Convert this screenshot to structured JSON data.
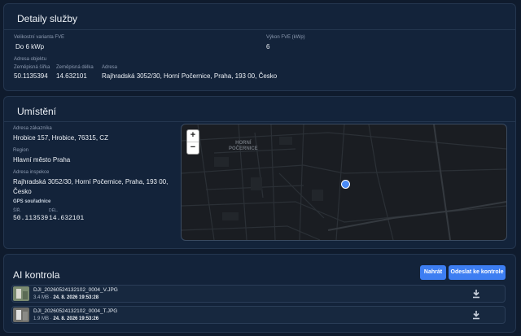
{
  "service": {
    "title": "Detaily služby",
    "variant_label": "Velikostní varianta FVE",
    "variant_value": "Do 6 kWp",
    "power_label": "Výkon FVE (kWp)",
    "power_value": "6",
    "address_object_label": "Adresa objektu",
    "lat_label": "Zeměpisná šířka",
    "lat_value": "50.1135394",
    "lon_label": "Zeměpisná délka",
    "lon_value": "14.632101",
    "address_label": "Adresa",
    "address_value": "Rajhradská 3052/30, Horní Počernice, Praha, 193 00, Česko"
  },
  "location": {
    "title": "Umístění",
    "customer_address_label": "Adresa zákazníka",
    "customer_address_value": "Hrobice 157, Hrobice, 76315, CZ",
    "region_label": "Region",
    "region_value": "Hlavní město Praha",
    "inspection_address_label": "Adresa inspekce",
    "inspection_address_line1": "Rajhradská 3052/30, Horní Počernice, Praha, 193 00,",
    "inspection_address_line2": "Česko",
    "gps_label": "GPS souřadnice",
    "gps_lat_label": "ŠÍŘ.",
    "gps_lat_value": "50.113539",
    "gps_lon_label": "DÉL.",
    "gps_lon_value": "14.632101",
    "map": {
      "zoom_in": "+",
      "zoom_out": "−",
      "district_line1": "HORNÍ",
      "district_line2": "POČERNICE",
      "marker_color": "#4a8af4"
    }
  },
  "ai": {
    "title": "AI kontrola",
    "upload_button": "Nahrát",
    "submit_button": "Odeslat ke kontrole",
    "files": [
      {
        "name": "DJI_20260524132102_0004_V.JPG",
        "size": "3.4 MB",
        "date": "24. 8. 2026 19:53:28"
      },
      {
        "name": "DJI_20260524132102_0004_T.JPG",
        "size": "1.9 MB",
        "date": "24. 8. 2026 19:53:26"
      }
    ]
  }
}
